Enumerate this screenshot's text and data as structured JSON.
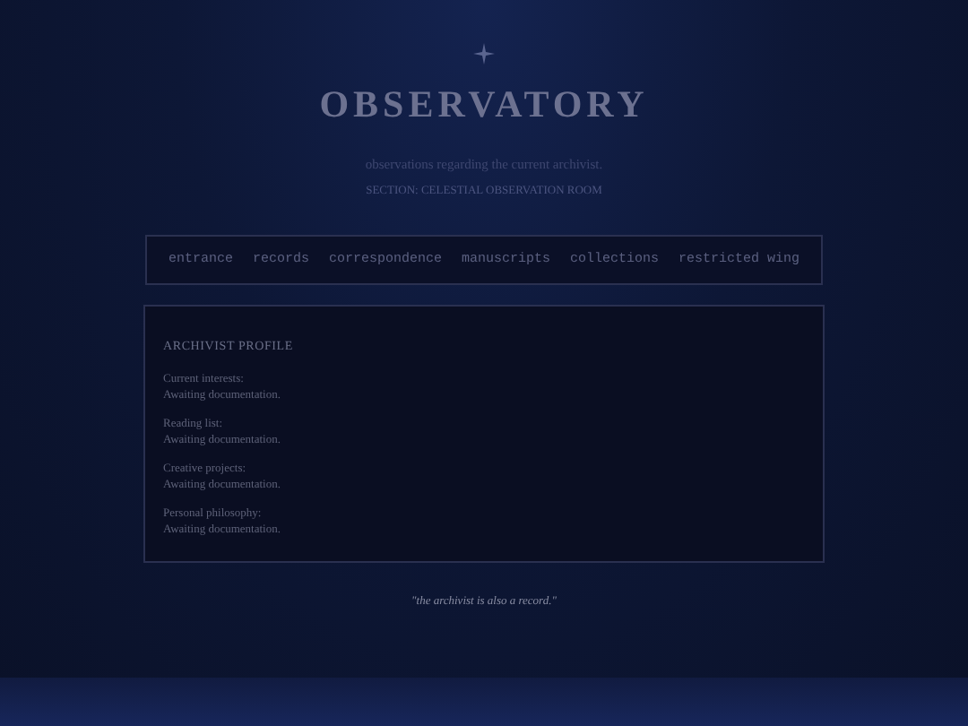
{
  "header": {
    "title": "OBSERVATORY",
    "subtitle": "observations regarding the current archivist.",
    "section": "SECTION: CELESTIAL OBSERVATION ROOM"
  },
  "nav": [
    "entrance",
    "records",
    "correspondence",
    "manuscripts",
    "collections",
    "restricted wing"
  ],
  "profile": {
    "heading": "ARCHIVIST PROFILE",
    "entries": [
      {
        "label": "Current interests:",
        "value": "Awaiting documentation."
      },
      {
        "label": "Reading list:",
        "value": "Awaiting documentation."
      },
      {
        "label": "Creative projects:",
        "value": "Awaiting documentation."
      },
      {
        "label": "Personal philosophy:",
        "value": "Awaiting documentation."
      }
    ]
  },
  "quote": "\"the archivist is also a record.\""
}
